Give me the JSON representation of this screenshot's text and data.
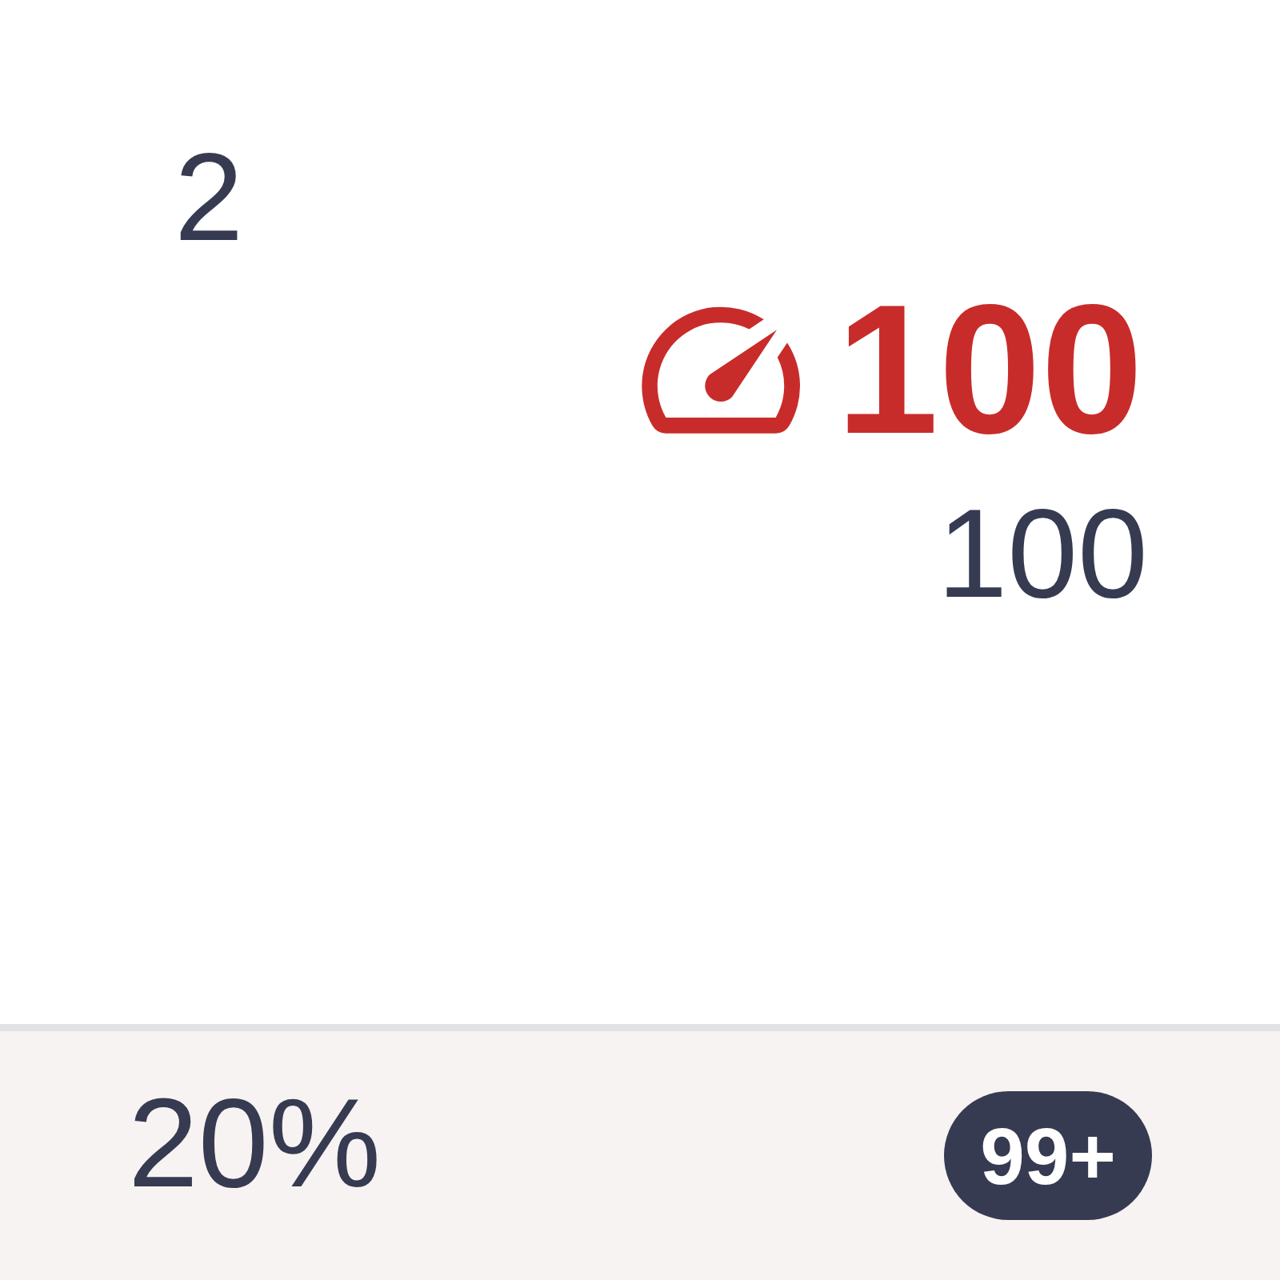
{
  "value": "2",
  "indicator": {
    "value": "100"
  },
  "secondary_value": "100",
  "footer": {
    "percentage": "20%",
    "badge": "99+"
  }
}
